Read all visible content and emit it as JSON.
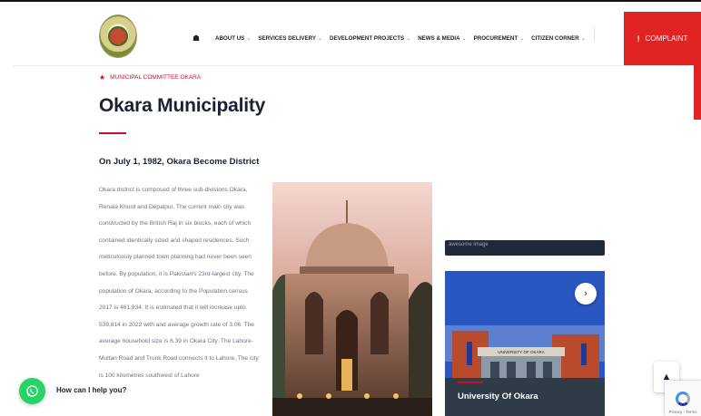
{
  "header": {
    "logo_name": "municipal-logo",
    "nav": [
      {
        "label": "ABOUT US",
        "has_menu": true
      },
      {
        "label": "SERVICES DELIVERY",
        "has_menu": true
      },
      {
        "label": "DEVELOPMENT PROJECTS",
        "has_menu": true
      },
      {
        "label": "NEWS & MEDIA",
        "has_menu": true
      },
      {
        "label": "PROCUREMENT",
        "has_menu": true
      },
      {
        "label": "CITIZEN CORNER",
        "has_menu": true
      }
    ],
    "complaint_label": "COMPLAINT"
  },
  "content": {
    "breadcrumb": "MUNICIPAL COMMITTEE OKARA",
    "title": "Okara Municipality",
    "subtitle": "On July 1, 1982, Okara Become District",
    "body": "Okara district is composed of three sub-divisions Okara, Renala Khurd and Depalpur. The current main city was constructed by the British Raj in six blocks, each of which contained identically sized and shaped residences. Such meticulously planned town planning had never been seen before. By population, it is Pakistan's 23rd-largest city. The population of Okara, according to the Population census 2017 is 461,934. It is estimated that it will increase upto 539,814 in 2022 with and average growth rate of 3.06. The average household size is 6.39 in Okara City. The Lahore-Multan Road and Trunk Road connects it to Lahore. The city is 100 kilometres southwest of Lahore"
  },
  "right_panel": {
    "broken_image_alt": "awesome image",
    "card_title": "University Of Okara",
    "card_sign": "UNIVERSITY OF OKARA"
  },
  "widgets": {
    "whatsapp_prompt": "How can I help you?",
    "recaptcha_text": "Privacy - Terms"
  },
  "colors": {
    "accent": "#c8102e",
    "complaint_bg": "#e02424",
    "whatsapp": "#25d366"
  }
}
